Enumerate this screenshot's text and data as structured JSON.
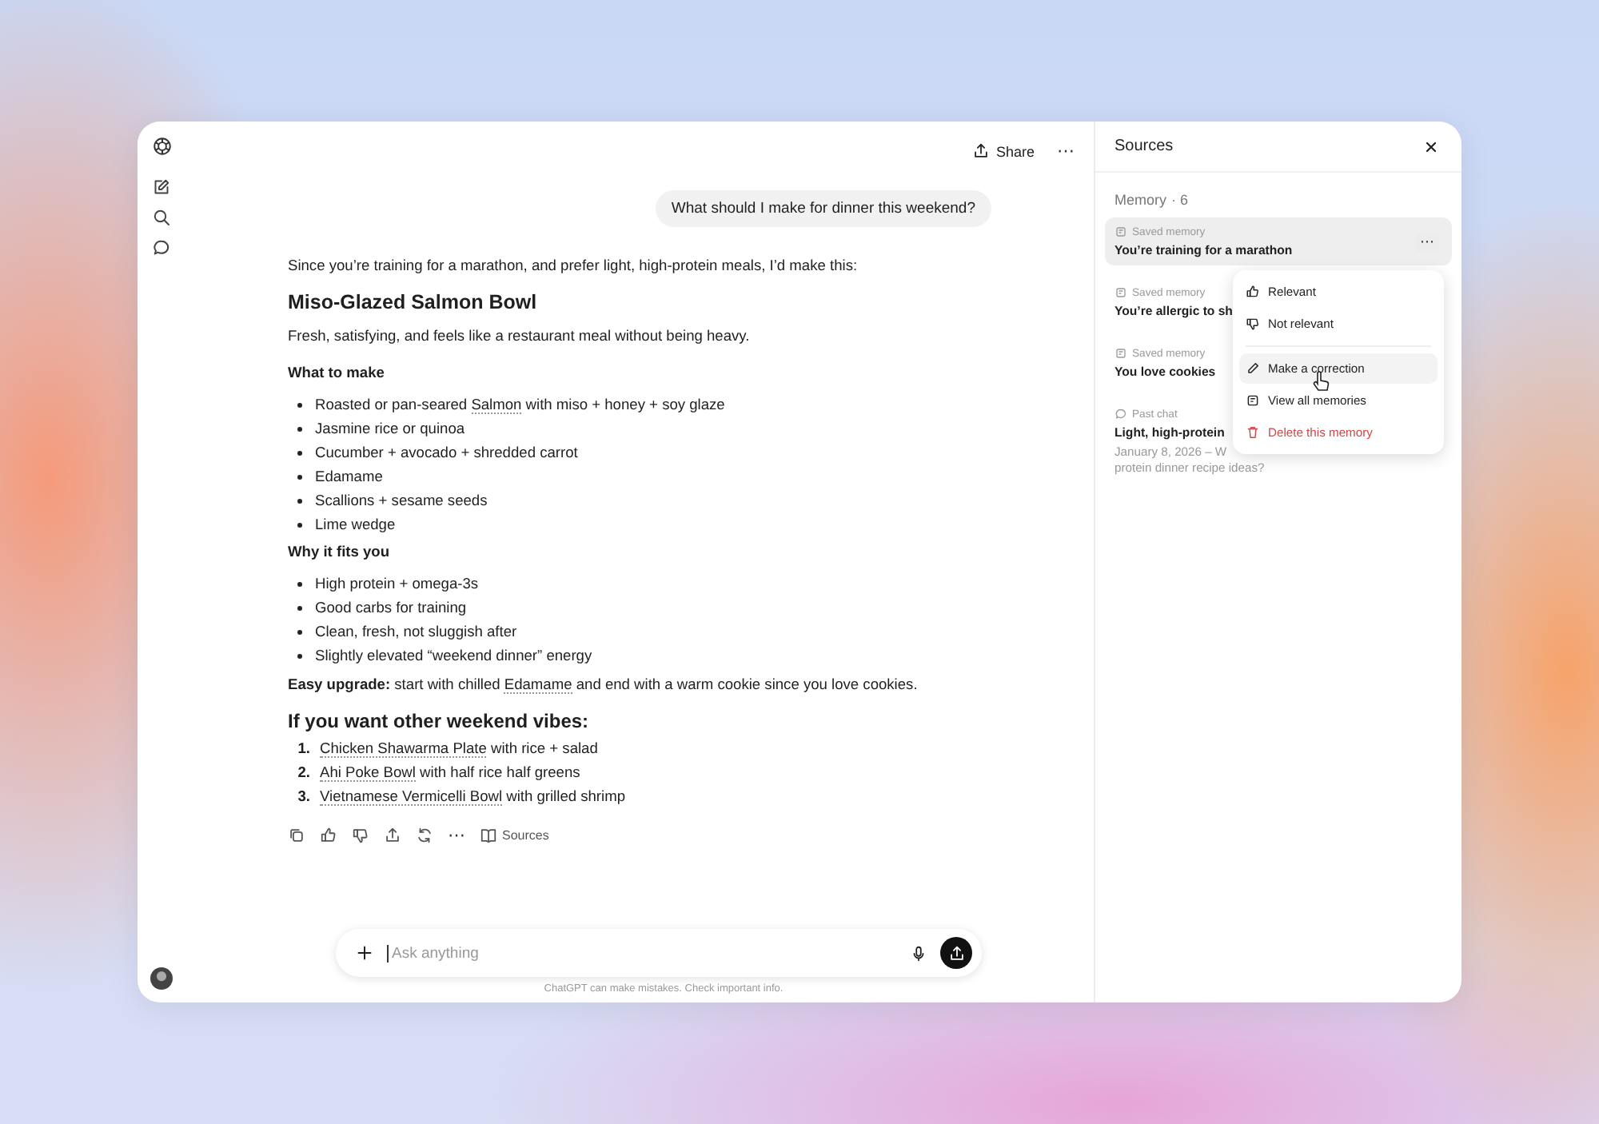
{
  "header": {
    "share": "Share",
    "more": "⋯"
  },
  "user_message": "What should I make for dinner this weekend?",
  "answer": {
    "intro": "Since you’re training for a marathon, and prefer light, high-protein meals, I’d make this:",
    "title": "Miso-Glazed Salmon Bowl",
    "subtitle": "Fresh, satisfying, and feels like a restaurant meal without being heavy.",
    "sections": [
      {
        "heading": "What to make",
        "bullets": [
          {
            "before": "Roasted or pan-seared ",
            "link": "Salmon",
            "after": " with miso + honey + soy glaze"
          },
          {
            "text": "Jasmine rice or quinoa"
          },
          {
            "text": "Cucumber + avocado + shredded carrot"
          },
          {
            "text": "Edamame"
          },
          {
            "text": "Scallions + sesame seeds"
          },
          {
            "text": "Lime wedge"
          }
        ]
      },
      {
        "heading": "Why it fits you",
        "bullets": [
          {
            "text": "High protein + omega-3s"
          },
          {
            "text": "Good carbs for training"
          },
          {
            "text": "Clean, fresh, not sluggish after"
          },
          {
            "text": "Slightly elevated “weekend dinner” energy"
          }
        ]
      }
    ],
    "upgrade": {
      "before": "**Easy upgrade:** start with chilled ",
      "link": "Edamame",
      "after": " and end with a warm cookie since you love cookies."
    },
    "alt_heading": "If you want other weekend vibes:",
    "alternatives": [
      {
        "number": "1.",
        "link": "Chicken Shawarma Plate",
        "rest": " with rice + salad"
      },
      {
        "number": "2.",
        "link": "Ahi Poke Bowl",
        "rest": " with half rice half greens"
      },
      {
        "number": "3.",
        "link": "Vietnamese Vermicelli Bowl",
        "rest": " with grilled shrimp"
      }
    ],
    "sources_button": "Sources"
  },
  "composer": {
    "placeholder": "Ask anything",
    "disclaimer": "ChatGPT can make mistakes. Check important info."
  },
  "sources_panel": {
    "title": "Sources",
    "section": "Memory",
    "count": "· 6",
    "items": [
      {
        "kind": "memory",
        "type_label": "Saved memory",
        "title": "You’re training for a marathon",
        "selected": true
      },
      {
        "kind": "memory",
        "type_label": "Saved memory",
        "title": "You’re allergic to sh",
        "selected": false
      },
      {
        "kind": "memory",
        "type_label": "Saved memory",
        "title": "You love cookies",
        "selected": false
      },
      {
        "kind": "chat",
        "type_label": "Past chat",
        "title": "Light, high-protein",
        "desc_1": "January 8, 2026 – W",
        "desc_2": "protein dinner recipe ideas?",
        "selected": false
      }
    ],
    "menu": [
      {
        "kind": "thumbs-up",
        "label": "Relevant",
        "selected": false,
        "danger": false
      },
      {
        "kind": "thumbs-down",
        "label": "Not relevant",
        "selected": false,
        "danger": false
      },
      {
        "kind": "divider"
      },
      {
        "kind": "pencil",
        "label": "Make a correction",
        "selected": true,
        "danger": false
      },
      {
        "kind": "memory",
        "label": "View all memories",
        "selected": false,
        "danger": false
      },
      {
        "kind": "trash",
        "label": "Delete this memory",
        "selected": false,
        "danger": true
      }
    ]
  }
}
